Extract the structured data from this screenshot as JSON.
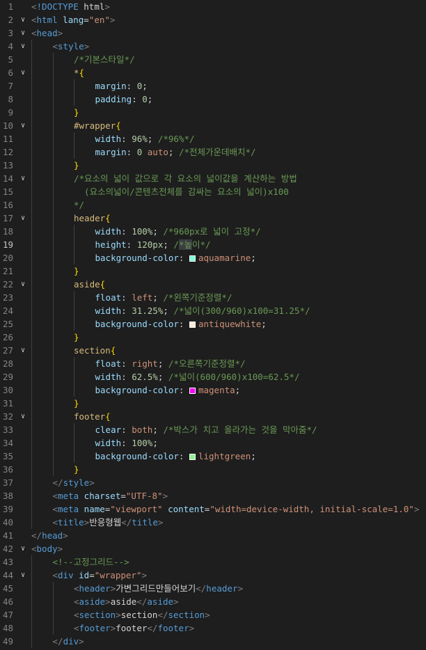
{
  "editor": {
    "active_line": 19,
    "lines": [
      {
        "n": 1,
        "indent": 0,
        "fold": false,
        "tokens": [
          [
            "punct",
            "<"
          ],
          [
            "tag",
            "!DOCTYPE"
          ],
          [
            "text",
            " html"
          ],
          [
            "punct",
            ">"
          ]
        ]
      },
      {
        "n": 2,
        "indent": 0,
        "fold": true,
        "tokens": [
          [
            "punct",
            "<"
          ],
          [
            "tag",
            "html"
          ],
          [
            "attr",
            " lang"
          ],
          [
            "text",
            "="
          ],
          [
            "str",
            "\"en\""
          ],
          [
            "punct",
            ">"
          ]
        ]
      },
      {
        "n": 3,
        "indent": 0,
        "fold": true,
        "tokens": [
          [
            "punct",
            "<"
          ],
          [
            "tag",
            "head"
          ],
          [
            "punct",
            ">"
          ]
        ]
      },
      {
        "n": 4,
        "indent": 1,
        "fold": true,
        "tokens": [
          [
            "punct",
            "<"
          ],
          [
            "tag",
            "style"
          ],
          [
            "punct",
            ">"
          ]
        ]
      },
      {
        "n": 5,
        "indent": 2,
        "fold": false,
        "tokens": [
          [
            "comment",
            "/*기본스타일*/"
          ]
        ]
      },
      {
        "n": 6,
        "indent": 2,
        "fold": true,
        "tokens": [
          [
            "sel",
            "*"
          ],
          [
            "brace",
            "{"
          ]
        ]
      },
      {
        "n": 7,
        "indent": 3,
        "fold": false,
        "tokens": [
          [
            "prop",
            "margin"
          ],
          [
            "text",
            ": "
          ],
          [
            "num",
            "0"
          ],
          [
            "text",
            ";"
          ]
        ]
      },
      {
        "n": 8,
        "indent": 3,
        "fold": false,
        "tokens": [
          [
            "prop",
            "padding"
          ],
          [
            "text",
            ": "
          ],
          [
            "num",
            "0"
          ],
          [
            "text",
            ";"
          ]
        ]
      },
      {
        "n": 9,
        "indent": 2,
        "fold": false,
        "tokens": [
          [
            "brace",
            "}"
          ]
        ]
      },
      {
        "n": 10,
        "indent": 2,
        "fold": true,
        "tokens": [
          [
            "sel",
            "#wrapper"
          ],
          [
            "brace",
            "{"
          ]
        ]
      },
      {
        "n": 11,
        "indent": 3,
        "fold": false,
        "tokens": [
          [
            "prop",
            "width"
          ],
          [
            "text",
            ": "
          ],
          [
            "num",
            "96%"
          ],
          [
            "text",
            "; "
          ],
          [
            "comment",
            "/*96%*/"
          ]
        ]
      },
      {
        "n": 12,
        "indent": 3,
        "fold": false,
        "tokens": [
          [
            "prop",
            "margin"
          ],
          [
            "text",
            ": "
          ],
          [
            "num",
            "0"
          ],
          [
            "text",
            " "
          ],
          [
            "val",
            "auto"
          ],
          [
            "text",
            "; "
          ],
          [
            "comment",
            "/*전체가운데배치*/"
          ]
        ]
      },
      {
        "n": 13,
        "indent": 2,
        "fold": false,
        "tokens": [
          [
            "brace",
            "}"
          ]
        ]
      },
      {
        "n": 14,
        "indent": 2,
        "fold": true,
        "tokens": [
          [
            "comment",
            "/*요소의 넓이 값으로 각 요소의 넓이값을 계산하는 방법"
          ]
        ]
      },
      {
        "n": 15,
        "indent": 2,
        "fold": false,
        "tokens": [
          [
            "comment",
            "  (요소의넓이/콘텐츠전체를 감싸는 요소의 넓이)x100"
          ]
        ]
      },
      {
        "n": 16,
        "indent": 2,
        "fold": false,
        "tokens": [
          [
            "comment",
            "*/"
          ]
        ]
      },
      {
        "n": 17,
        "indent": 2,
        "fold": true,
        "tokens": [
          [
            "sel",
            "header"
          ],
          [
            "brace",
            "{"
          ]
        ]
      },
      {
        "n": 18,
        "indent": 3,
        "fold": false,
        "tokens": [
          [
            "prop",
            "width"
          ],
          [
            "text",
            ": "
          ],
          [
            "num",
            "100%"
          ],
          [
            "text",
            "; "
          ],
          [
            "comment",
            "/*960px로 넓이 고정*/"
          ]
        ]
      },
      {
        "n": 19,
        "indent": 3,
        "fold": false,
        "tokens": [
          [
            "prop",
            "height"
          ],
          [
            "text",
            ": "
          ],
          [
            "num",
            "120px"
          ],
          [
            "text",
            "; "
          ],
          [
            "comment",
            "/"
          ],
          [
            "commenthl",
            "*높"
          ],
          [
            "comment",
            "이*/"
          ]
        ]
      },
      {
        "n": 20,
        "indent": 3,
        "fold": false,
        "tokens": [
          [
            "prop",
            "background-color"
          ],
          [
            "text",
            ": "
          ],
          [
            "swatch",
            "#7fffd4"
          ],
          [
            "val",
            "aquamarine"
          ],
          [
            "text",
            ";"
          ]
        ]
      },
      {
        "n": 21,
        "indent": 2,
        "fold": false,
        "tokens": [
          [
            "brace",
            "}"
          ]
        ]
      },
      {
        "n": 22,
        "indent": 2,
        "fold": true,
        "tokens": [
          [
            "sel",
            "aside"
          ],
          [
            "brace",
            "{"
          ]
        ]
      },
      {
        "n": 23,
        "indent": 3,
        "fold": false,
        "tokens": [
          [
            "prop",
            "float"
          ],
          [
            "text",
            ": "
          ],
          [
            "val",
            "left"
          ],
          [
            "text",
            "; "
          ],
          [
            "comment",
            "/*왼쪽기준정렬*/"
          ]
        ]
      },
      {
        "n": 24,
        "indent": 3,
        "fold": false,
        "tokens": [
          [
            "prop",
            "width"
          ],
          [
            "text",
            ": "
          ],
          [
            "num",
            "31.25%"
          ],
          [
            "text",
            "; "
          ],
          [
            "comment",
            "/*넓이(300/960)x100=31.25*/"
          ]
        ]
      },
      {
        "n": 25,
        "indent": 3,
        "fold": false,
        "tokens": [
          [
            "prop",
            "background-color"
          ],
          [
            "text",
            ": "
          ],
          [
            "swatch",
            "#faebd7"
          ],
          [
            "val",
            "antiquewhite"
          ],
          [
            "text",
            ";"
          ]
        ]
      },
      {
        "n": 26,
        "indent": 2,
        "fold": false,
        "tokens": [
          [
            "brace",
            "}"
          ]
        ]
      },
      {
        "n": 27,
        "indent": 2,
        "fold": true,
        "tokens": [
          [
            "sel",
            "section"
          ],
          [
            "brace",
            "{"
          ]
        ]
      },
      {
        "n": 28,
        "indent": 3,
        "fold": false,
        "tokens": [
          [
            "prop",
            "float"
          ],
          [
            "text",
            ": "
          ],
          [
            "val",
            "right"
          ],
          [
            "text",
            "; "
          ],
          [
            "comment",
            "/*오른쪽기준정렬*/"
          ]
        ]
      },
      {
        "n": 29,
        "indent": 3,
        "fold": false,
        "tokens": [
          [
            "prop",
            "width"
          ],
          [
            "text",
            ": "
          ],
          [
            "num",
            "62.5%"
          ],
          [
            "text",
            "; "
          ],
          [
            "comment",
            "/*넓이(600/960)x100=62.5*/"
          ]
        ]
      },
      {
        "n": 30,
        "indent": 3,
        "fold": false,
        "tokens": [
          [
            "prop",
            "background-color"
          ],
          [
            "text",
            ": "
          ],
          [
            "swatch",
            "#ff00ff"
          ],
          [
            "val",
            "magenta"
          ],
          [
            "text",
            ";"
          ]
        ]
      },
      {
        "n": 31,
        "indent": 2,
        "fold": false,
        "tokens": [
          [
            "brace",
            "}"
          ]
        ]
      },
      {
        "n": 32,
        "indent": 2,
        "fold": true,
        "tokens": [
          [
            "sel",
            "footer"
          ],
          [
            "brace",
            "{"
          ]
        ]
      },
      {
        "n": 33,
        "indent": 3,
        "fold": false,
        "tokens": [
          [
            "prop",
            "clear"
          ],
          [
            "text",
            ": "
          ],
          [
            "val",
            "both"
          ],
          [
            "text",
            "; "
          ],
          [
            "comment",
            "/*박스가 치고 올라가는 것을 막아줌*/"
          ]
        ]
      },
      {
        "n": 34,
        "indent": 3,
        "fold": false,
        "tokens": [
          [
            "prop",
            "width"
          ],
          [
            "text",
            ": "
          ],
          [
            "num",
            "100%"
          ],
          [
            "text",
            ";"
          ]
        ]
      },
      {
        "n": 35,
        "indent": 3,
        "fold": false,
        "tokens": [
          [
            "prop",
            "background-color"
          ],
          [
            "text",
            ": "
          ],
          [
            "swatch",
            "#90ee90"
          ],
          [
            "val",
            "lightgreen"
          ],
          [
            "text",
            ";"
          ]
        ]
      },
      {
        "n": 36,
        "indent": 2,
        "fold": false,
        "tokens": [
          [
            "brace",
            "}"
          ]
        ]
      },
      {
        "n": 37,
        "indent": 1,
        "fold": false,
        "tokens": [
          [
            "punct",
            "</"
          ],
          [
            "tag",
            "style"
          ],
          [
            "punct",
            ">"
          ]
        ]
      },
      {
        "n": 38,
        "indent": 1,
        "fold": false,
        "tokens": [
          [
            "punct",
            "<"
          ],
          [
            "tag",
            "meta"
          ],
          [
            "attr",
            " charset"
          ],
          [
            "text",
            "="
          ],
          [
            "str",
            "\"UTF-8\""
          ],
          [
            "punct",
            ">"
          ]
        ]
      },
      {
        "n": 39,
        "indent": 1,
        "fold": false,
        "tokens": [
          [
            "punct",
            "<"
          ],
          [
            "tag",
            "meta"
          ],
          [
            "attr",
            " name"
          ],
          [
            "text",
            "="
          ],
          [
            "str",
            "\"viewport\""
          ],
          [
            "attr",
            " content"
          ],
          [
            "text",
            "="
          ],
          [
            "str",
            "\"width=device-width, initial-scale=1.0\""
          ],
          [
            "punct",
            ">"
          ]
        ]
      },
      {
        "n": 40,
        "indent": 1,
        "fold": false,
        "tokens": [
          [
            "punct",
            "<"
          ],
          [
            "tag",
            "title"
          ],
          [
            "punct",
            ">"
          ],
          [
            "text",
            "반응형웹"
          ],
          [
            "punct",
            "</"
          ],
          [
            "tag",
            "title"
          ],
          [
            "punct",
            ">"
          ]
        ]
      },
      {
        "n": 41,
        "indent": 0,
        "fold": false,
        "tokens": [
          [
            "punct",
            "</"
          ],
          [
            "tag",
            "head"
          ],
          [
            "punct",
            ">"
          ]
        ]
      },
      {
        "n": 42,
        "indent": 0,
        "fold": true,
        "tokens": [
          [
            "punct",
            "<"
          ],
          [
            "tag",
            "body"
          ],
          [
            "punct",
            ">"
          ]
        ]
      },
      {
        "n": 43,
        "indent": 1,
        "fold": false,
        "tokens": [
          [
            "comment",
            "<!--고정그리드-->"
          ]
        ]
      },
      {
        "n": 44,
        "indent": 1,
        "fold": true,
        "tokens": [
          [
            "punct",
            "<"
          ],
          [
            "tag",
            "div"
          ],
          [
            "attr",
            " id"
          ],
          [
            "text",
            "="
          ],
          [
            "str",
            "\"wrapper\""
          ],
          [
            "punct",
            ">"
          ]
        ]
      },
      {
        "n": 45,
        "indent": 2,
        "fold": false,
        "tokens": [
          [
            "punct",
            "<"
          ],
          [
            "tag",
            "header"
          ],
          [
            "punct",
            ">"
          ],
          [
            "text",
            "가변그리드만들어보기"
          ],
          [
            "punct",
            "</"
          ],
          [
            "tag",
            "header"
          ],
          [
            "punct",
            ">"
          ]
        ]
      },
      {
        "n": 46,
        "indent": 2,
        "fold": false,
        "tokens": [
          [
            "punct",
            "<"
          ],
          [
            "tag",
            "aside"
          ],
          [
            "punct",
            ">"
          ],
          [
            "text",
            "aside"
          ],
          [
            "punct",
            "</"
          ],
          [
            "tag",
            "aside"
          ],
          [
            "punct",
            ">"
          ]
        ]
      },
      {
        "n": 47,
        "indent": 2,
        "fold": false,
        "tokens": [
          [
            "punct",
            "<"
          ],
          [
            "tag",
            "section"
          ],
          [
            "punct",
            ">"
          ],
          [
            "text",
            "section"
          ],
          [
            "punct",
            "</"
          ],
          [
            "tag",
            "section"
          ],
          [
            "punct",
            ">"
          ]
        ]
      },
      {
        "n": 48,
        "indent": 2,
        "fold": false,
        "tokens": [
          [
            "punct",
            "<"
          ],
          [
            "tag",
            "footer"
          ],
          [
            "punct",
            ">"
          ],
          [
            "text",
            "footer"
          ],
          [
            "punct",
            "</"
          ],
          [
            "tag",
            "footer"
          ],
          [
            "punct",
            ">"
          ]
        ]
      },
      {
        "n": 49,
        "indent": 1,
        "fold": false,
        "tokens": [
          [
            "punct",
            "</"
          ],
          [
            "tag",
            "div"
          ],
          [
            "punct",
            ">"
          ]
        ]
      }
    ],
    "fold_icon": "chevron-down-icon",
    "fold_glyph": "∨"
  }
}
